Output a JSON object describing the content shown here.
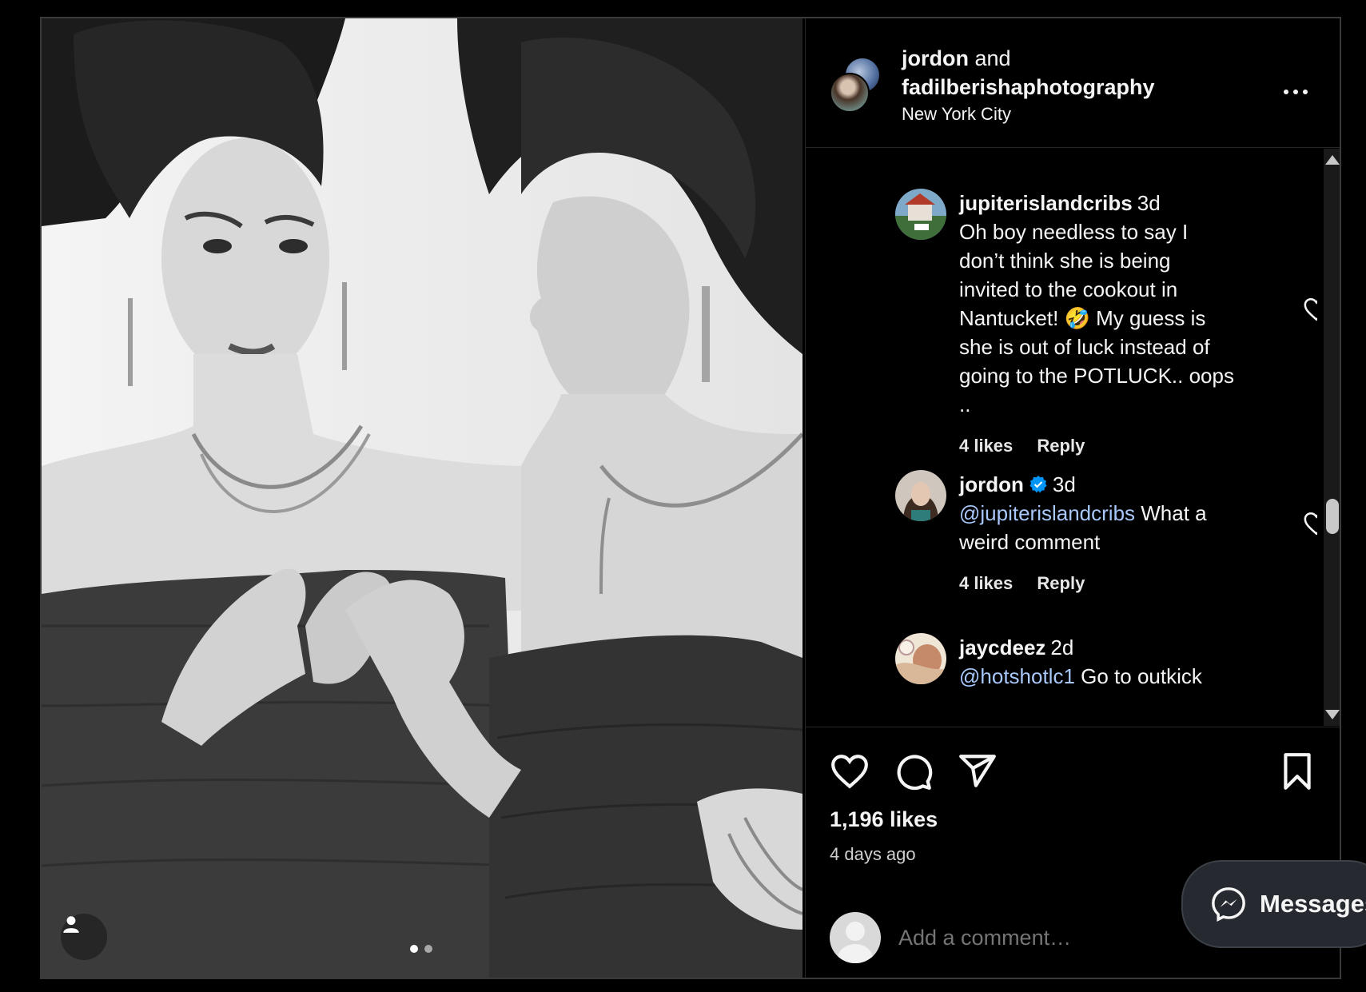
{
  "post": {
    "header": {
      "user1": "jordon",
      "and": "and",
      "user2": "fadilberishaphotography",
      "location": "New York City"
    },
    "carousel": {
      "total": 2,
      "current": 1
    },
    "comments": [
      {
        "username": "jupiterislandcribs",
        "time": "3d",
        "verified": false,
        "lines": [
          "Oh boy needless to say I",
          "don’t think she is being",
          "invited to the cookout in",
          "Nantucket! 🤣 My guess is",
          "she is out of luck instead of",
          "going to the POTLUCK.. oops",
          ".."
        ],
        "likes": "4 likes",
        "reply": "Reply"
      },
      {
        "username": "jordon",
        "time": "3d",
        "verified": true,
        "mention": "@jupiterislandcribs",
        "text_after_mention": " What a",
        "lines": [
          "weird comment"
        ],
        "likes": "4 likes",
        "reply": "Reply"
      },
      {
        "username": "jaycdeez",
        "time": "2d",
        "verified": false,
        "mention": "@hotshotlc1",
        "text_after_mention": " Go to outkick"
      }
    ],
    "likes_count": "1,196 likes",
    "posted_ago": "4 days ago",
    "comment_placeholder": "Add a comment…"
  },
  "messages_button": {
    "label": "Messages"
  },
  "icons": {
    "like": "heart-icon",
    "comment": "comment-icon",
    "share": "share-icon",
    "save": "bookmark-icon",
    "more": "more-icon",
    "messenger": "messenger-icon",
    "tag": "user-tag-icon"
  },
  "colors": {
    "background": "#000000",
    "mention": "#a8c7fa",
    "verified": "#0095f6"
  }
}
